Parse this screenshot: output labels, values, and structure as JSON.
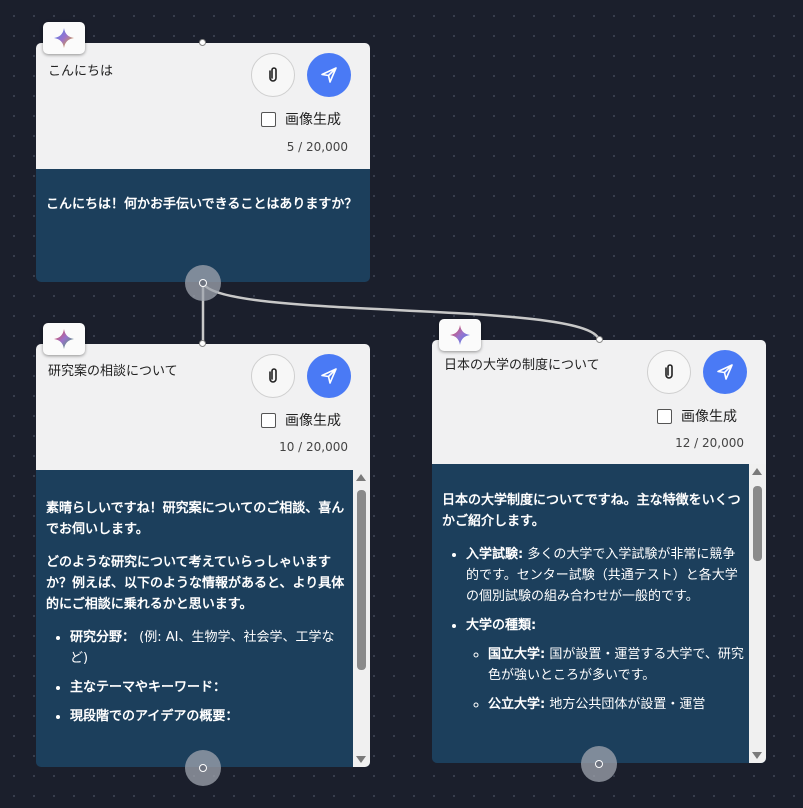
{
  "nodes": {
    "greeting": {
      "prompt": "こんにちは",
      "image_gen_label": "画像生成",
      "char_count": "5 / 20,000",
      "response": "こんにちは！何かお手伝いできることはありますか？"
    },
    "research": {
      "prompt": "研究案の相談について",
      "image_gen_label": "画像生成",
      "char_count": "10 / 20,000",
      "response": {
        "p1": "素晴らしいですね！研究案についてのご相談、喜んでお伺いします。",
        "p2": "どのような研究について考えていらっしゃいますか？例えば、以下のような情報があると、より具体的にご相談に乗れるかと思います。",
        "items": [
          {
            "bold": "研究分野：",
            "text": " (例: AI、生物学、社会学、工学など)"
          },
          {
            "bold": "主なテーマやキーワード：",
            "text": ""
          },
          {
            "bold": "現段階でのアイデアの概要：",
            "text": ""
          }
        ]
      }
    },
    "university": {
      "prompt": "日本の大学の制度について",
      "image_gen_label": "画像生成",
      "char_count": "12 / 20,000",
      "response": {
        "p1": "日本の大学制度についてですね。主な特徴をいくつかご紹介します。",
        "item1_bold": "入学試験:",
        "item1_text": " 多くの大学で入学試験が非常に競争的です。センター試験（共通テスト）と各大学の個別試験の組み合わせが一般的です。",
        "item2_bold": "大学の種類:",
        "sub1_bold": "国立大学:",
        "sub1_text": " 国が設置・運営する大学で、研究色が強いところが多いです。",
        "sub2_bold": "公立大学:",
        "sub2_text": " 地方公共団体が設置・運営"
      }
    }
  },
  "icons": {
    "badge": "gemini-sparkle-icon",
    "attach": "paperclip-icon",
    "send": "send-icon"
  },
  "colors": {
    "canvas": "#1b1f2c",
    "response_bg": "#1c3f5c",
    "send_button": "#4a7af5",
    "input_bg": "#f1f1f2"
  }
}
